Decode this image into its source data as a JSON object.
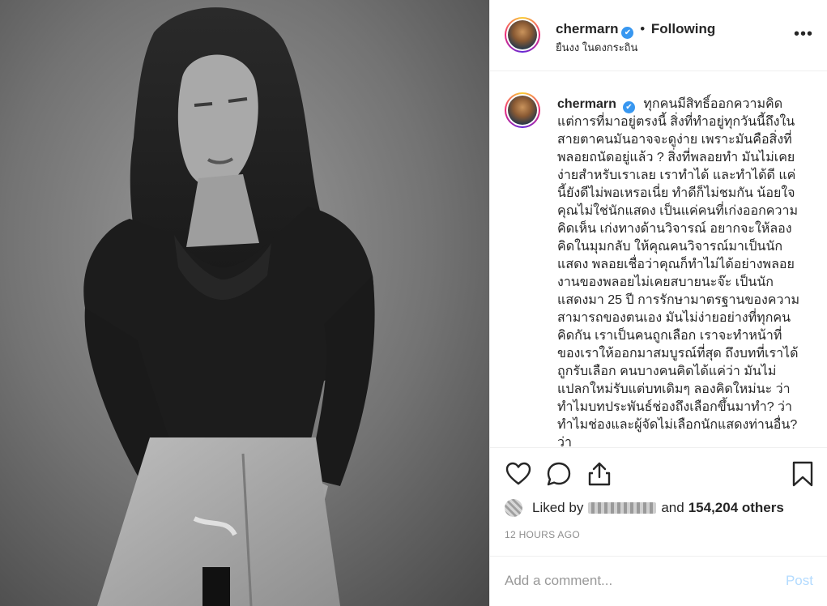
{
  "header": {
    "username": "chermarn",
    "verified_symbol": "✔",
    "separator": "•",
    "follow_status": "Following",
    "location": "ยืนงง ในดงกระถิน",
    "more_symbol": "•••"
  },
  "caption": {
    "username": "chermarn",
    "verified_symbol": "✔",
    "text": "ทุกคนมีสิทธิ์ออกความคิด แต่การที่มาอยู่ตรงนี้ สิ่งที่ทำอยู่ทุกวันนี้ถึงในสายตาคนมันอาจจะดูง่าย เพราะมันคือสิ่งที่พลอยถนัดอยู่แล้ว ? สิ่งที่พลอยทำ มันไม่เคยง่ายสำหรับเราเลย เราทำได้ และทำได้ดี แค่นี้ยังดีไม่พอเหรอเนี่ย ทำดีก็ไม่ชมกัน น้อยใจ คุณไม่ใช่นักแสดง เป็นแค่คนที่เก่งออกความคิดเห็น เก่งทางด้านวิจารณ์ อยากจะให้ลองคิดในมุมกลับ ให้คุณคนวิจารณ์มาเป็นนักแสดง พลอยเชื่อว่าคุณก็ทำไม่ได้อย่างพลอย งานของพลอยไม่เคยสบายนะจ๊ะ เป็นนักแสดงมา 25 ปี การรักษามาตรฐานของความสามารถของตนเอง มันไม่ง่ายอย่างที่ทุกคนคิดกัน เราเป็นคนถูกเลือก เราจะทำหน้าที่ของเราให้ออกมาสมบูรณ์ที่สุด ถึงบทที่เราได้ถูกรับเลือก คนบางคนคิดได้แค่ว่า มันไม่แปลกใหม่รับแต่บทเดิมๆ ลองคิดใหม่นะ ว่าทำไมบทประพันธ์ช่องถึงเลือกขึ้นมาทำ? ว่าทำไมช่องและผู้จัดไม่เลือกนักแสดงท่านอื่น? ว่า"
  },
  "actions": {
    "like": "heart-outline",
    "comment": "speech-bubble",
    "share": "share-arrow",
    "save": "bookmark"
  },
  "likes": {
    "prefix": "Liked by",
    "connector": "and",
    "count": "154,204 others"
  },
  "timestamp": "12 HOURS AGO",
  "comment_box": {
    "placeholder": "Add a comment...",
    "post_label": "Post"
  },
  "colors": {
    "verified": "#3897f0",
    "post_disabled": "#b3dbff",
    "muted": "#8e8e8e"
  }
}
